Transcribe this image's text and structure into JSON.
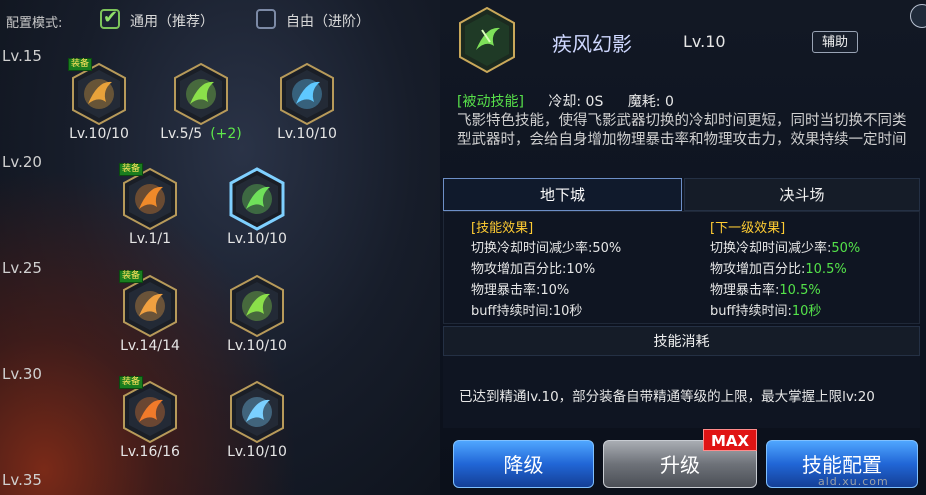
{
  "config": {
    "label": "配置模式:",
    "options": [
      {
        "label": "通用（推荐）",
        "checked": true
      },
      {
        "label": "自由（进阶）",
        "checked": false
      }
    ]
  },
  "level_rows": [
    "Lv.15",
    "Lv.20",
    "Lv.25",
    "Lv.30",
    "Lv.35"
  ],
  "equip_badge": "装备",
  "skills": [
    {
      "id": "s1",
      "level": "Lv.10/10",
      "plus": "",
      "equipped": true,
      "color": "#e8a23a"
    },
    {
      "id": "s2",
      "level": "Lv.5/5",
      "plus": "(+2)",
      "equipped": false,
      "color": "#8be04a"
    },
    {
      "id": "s3",
      "level": "Lv.10/10",
      "plus": "",
      "equipped": false,
      "color": "#5ec8ff"
    },
    {
      "id": "s4",
      "level": "Lv.1/1",
      "plus": "",
      "equipped": true,
      "color": "#f08a2a"
    },
    {
      "id": "s5",
      "level": "Lv.10/10",
      "plus": "",
      "equipped": false,
      "color": "#6fe05a",
      "selected": true
    },
    {
      "id": "s6",
      "level": "Lv.14/14",
      "plus": "",
      "equipped": true,
      "color": "#f0a040"
    },
    {
      "id": "s7",
      "level": "Lv.10/10",
      "plus": "",
      "equipped": false,
      "color": "#8be04a"
    },
    {
      "id": "s8",
      "level": "Lv.16/16",
      "plus": "",
      "equipped": true,
      "color": "#f07a2a"
    },
    {
      "id": "s9",
      "level": "Lv.10/10",
      "plus": "",
      "equipped": false,
      "color": "#7ad0ff"
    }
  ],
  "detail": {
    "name": "疾风幻影",
    "level": "Lv.10",
    "tag": "辅助",
    "type": "[被动技能]",
    "cooldown": "冷却: 0S",
    "mana": "魔耗: 0",
    "description": "飞影特色技能，使得飞影武器切换的冷却时间更短，同时当切换不同类型武器时，会给自身增加物理暴击率和物理攻击力，效果持续一定时间"
  },
  "tabs": {
    "dungeon": "地下城",
    "arena": "决斗场"
  },
  "effects": {
    "current_title": "[技能效果]",
    "next_title": "[下一级效果]",
    "current": [
      {
        "label": "切换冷却时间减少率:",
        "value": "50%"
      },
      {
        "label": "物攻增加百分比:",
        "value": "10%"
      },
      {
        "label": "物理暴击率:",
        "value": "10%"
      },
      {
        "label": "buff持续时间:",
        "value": "10秒"
      }
    ],
    "next": [
      {
        "label": "切换冷却时间减少率:",
        "value": "50%"
      },
      {
        "label": "物攻增加百分比:",
        "value": "10.5%"
      },
      {
        "label": "物理暴击率:",
        "value": "10.5%"
      },
      {
        "label": "buff持续时间:",
        "value": "10秒"
      }
    ]
  },
  "cost_title": "技能消耗",
  "mastery_info": "已达到精通lv.10，部分装备自带精通等级的上限，最大掌握上限lv:20",
  "buttons": {
    "downgrade": "降级",
    "upgrade": "升级",
    "max_badge": "MAX",
    "config": "技能配置"
  },
  "watermark": "ald.xu.com"
}
